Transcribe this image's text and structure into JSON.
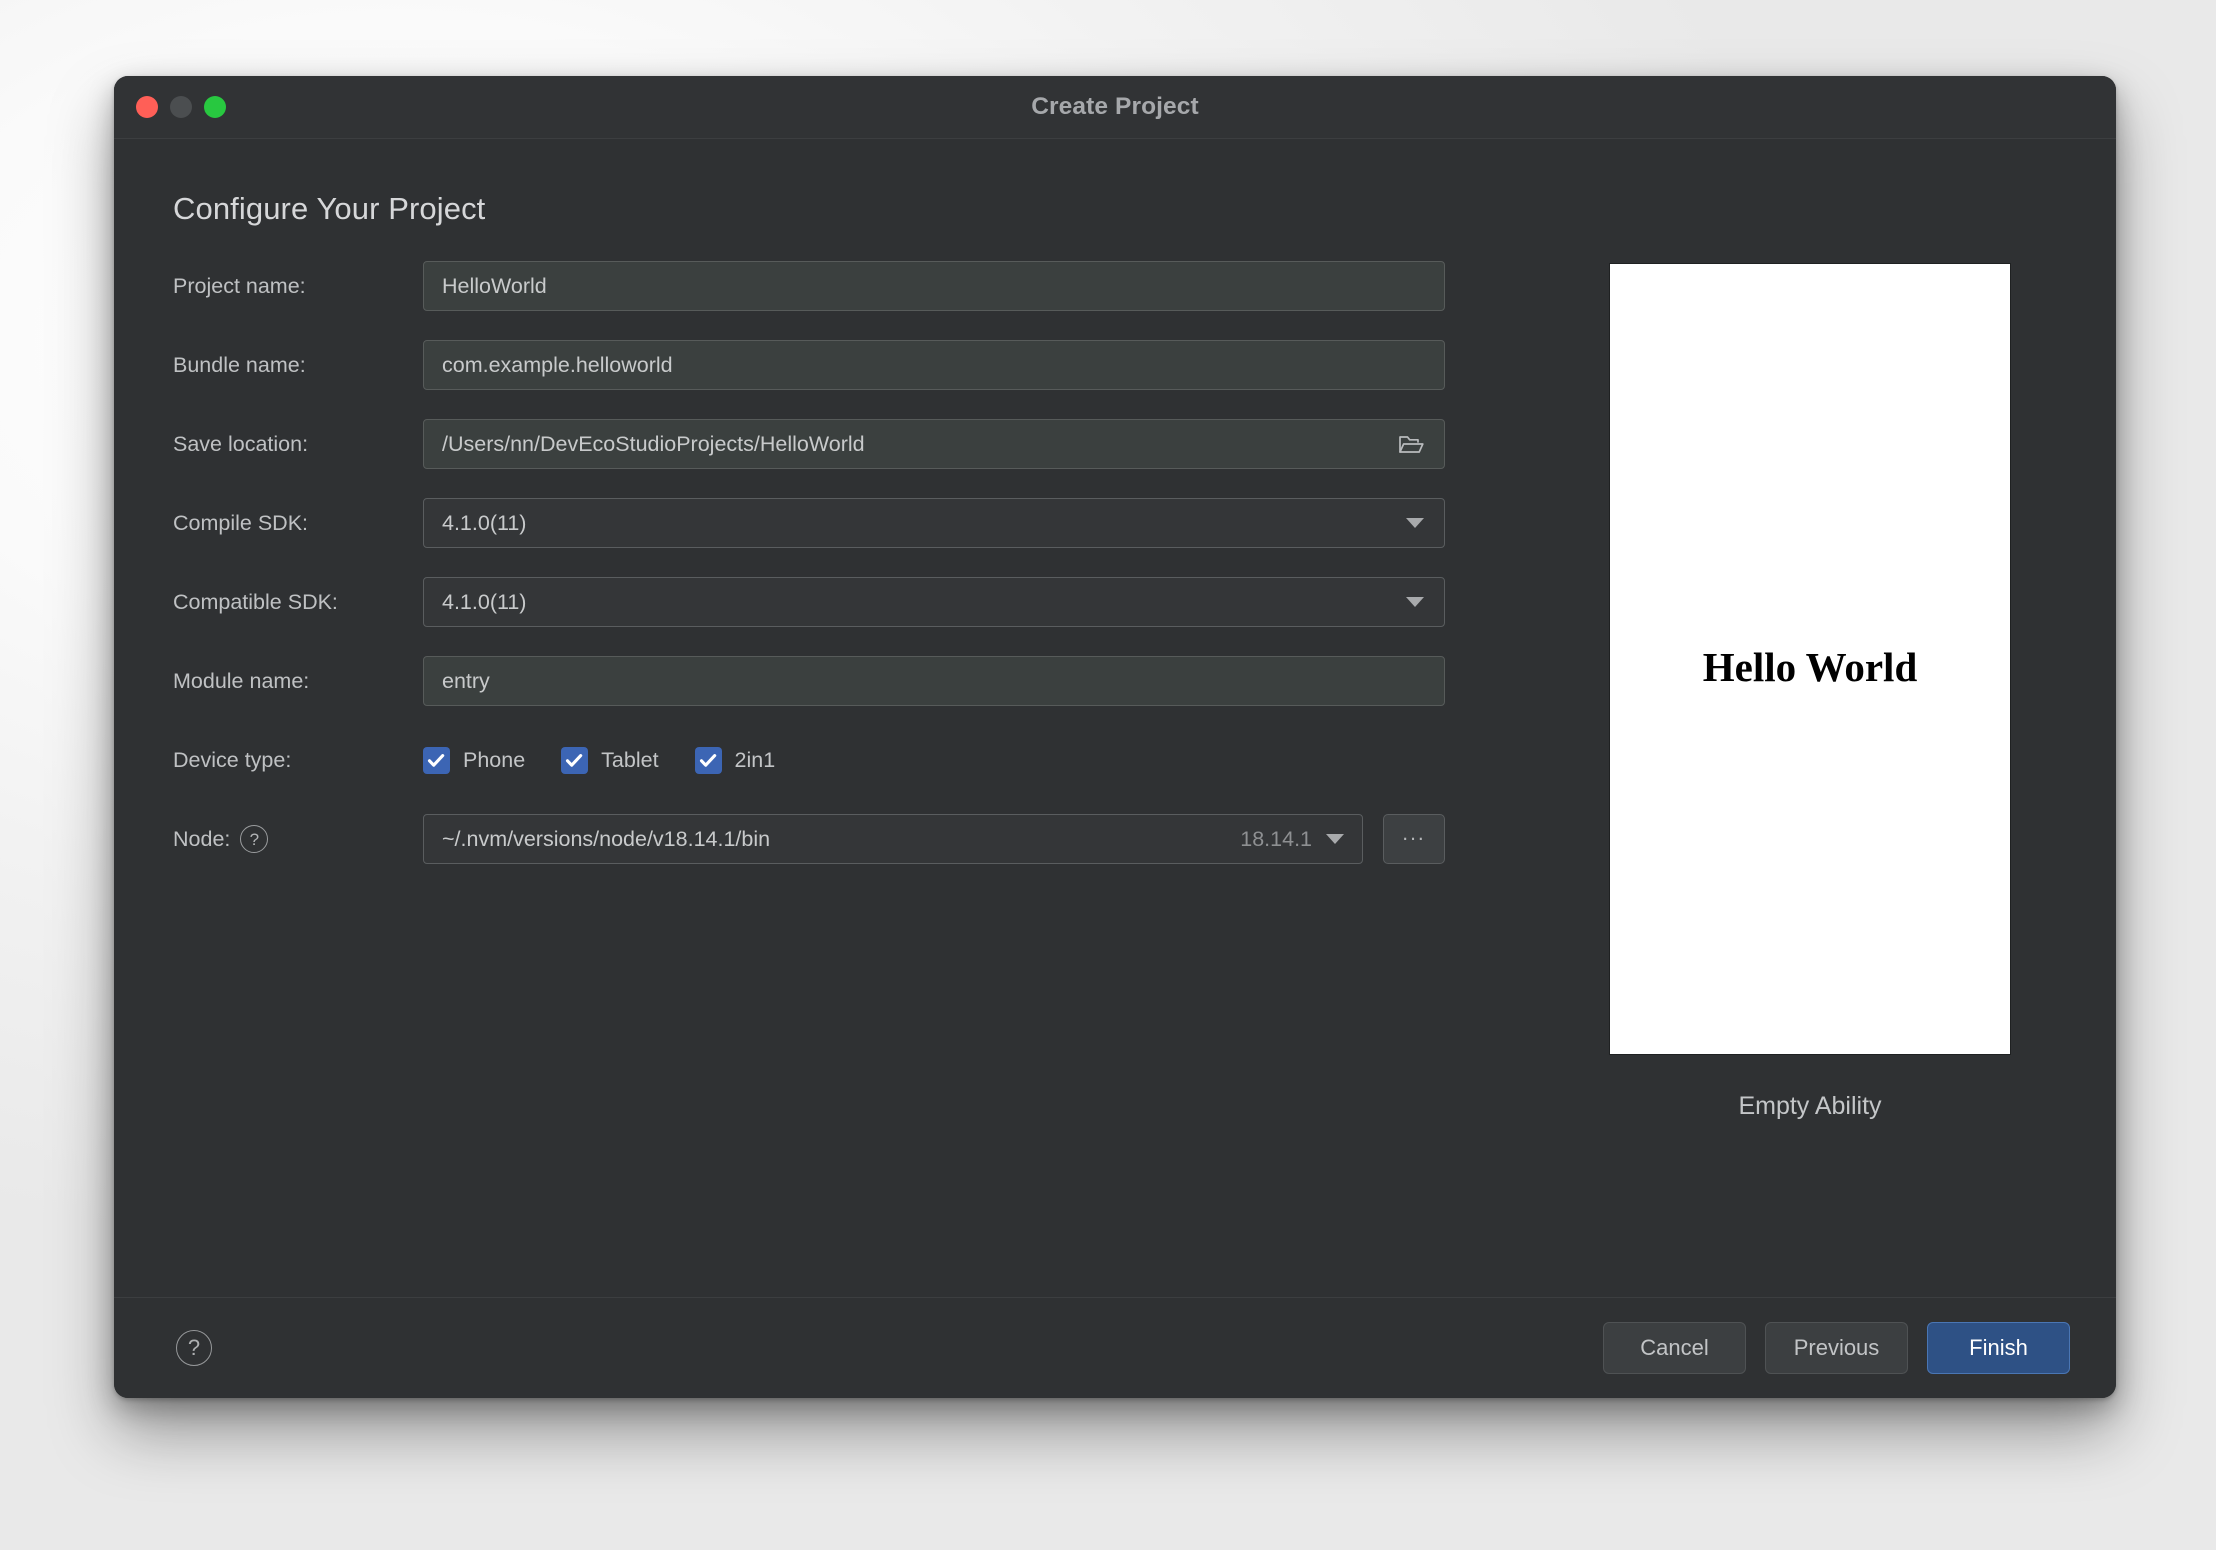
{
  "window": {
    "title": "Create Project",
    "traffic_lights": [
      "close-button",
      "minimize-button",
      "zoom-button"
    ]
  },
  "heading": "Configure Your Project",
  "form": {
    "project_name": {
      "label": "Project name:",
      "value": "HelloWorld"
    },
    "bundle_name": {
      "label": "Bundle name:",
      "value": "com.example.helloworld"
    },
    "save_location": {
      "label": "Save location:",
      "value": "/Users/nn/DevEcoStudioProjects/HelloWorld",
      "browse_icon": "folder-open-icon"
    },
    "compile_sdk": {
      "label": "Compile SDK:",
      "value": "4.1.0(11)",
      "caret_icon": "chevron-down-icon"
    },
    "compatible_sdk": {
      "label": "Compatible SDK:",
      "value": "4.1.0(11)",
      "caret_icon": "chevron-down-icon"
    },
    "module_name": {
      "label": "Module name:",
      "value": "entry"
    },
    "device_type": {
      "label": "Device type:",
      "options": [
        {
          "label": "Phone",
          "checked": true
        },
        {
          "label": "Tablet",
          "checked": true
        },
        {
          "label": "2in1",
          "checked": true
        }
      ]
    },
    "node": {
      "label": "Node:",
      "help_icon": "help-circle-icon",
      "value": "~/.nvm/versions/node/v18.14.1/bin",
      "version": "18.14.1",
      "caret_icon": "chevron-down-icon",
      "browse_label": "..."
    }
  },
  "preview": {
    "text": "Hello World",
    "caption": "Empty Ability"
  },
  "footer": {
    "help_icon": "help-circle-icon",
    "cancel_label": "Cancel",
    "previous_label": "Previous",
    "finish_label": "Finish"
  },
  "colors": {
    "window_bg": "#2f3133",
    "titlebar_bg": "#313335",
    "text_input_bg": "#3b403f",
    "select_bg": "#343638",
    "checkbox_accent": "#3c65b4",
    "primary_button_bg": "#2e5185",
    "primary_button_border": "#4a76b4",
    "close_light": "#ff5f57",
    "minimize_light": "#4b4e50",
    "zoom_light": "#28c840"
  }
}
